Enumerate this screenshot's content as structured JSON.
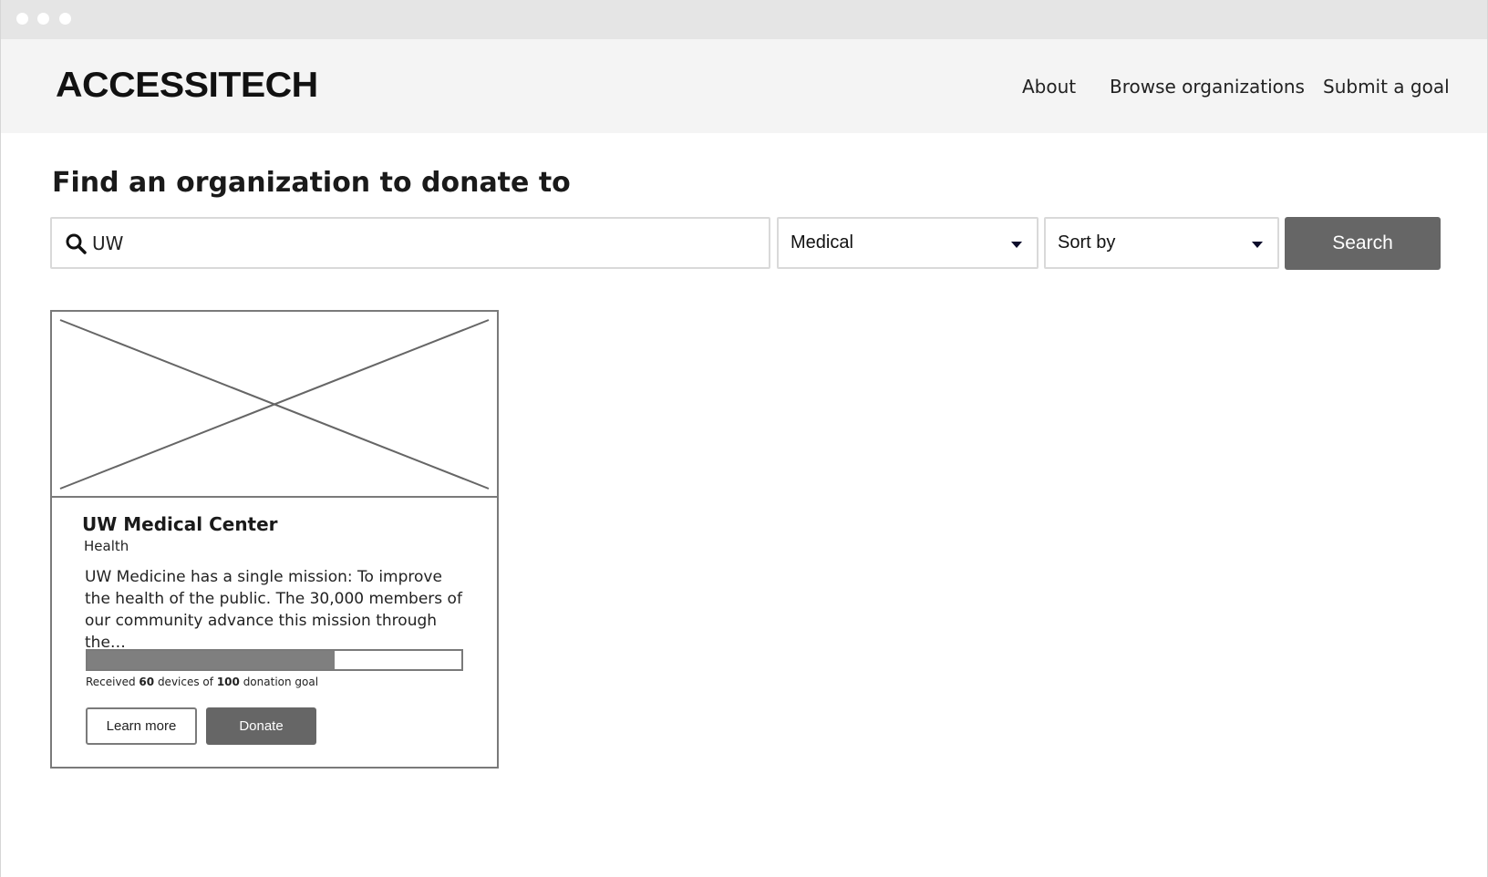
{
  "app": {
    "logo": "ACCESSITECH"
  },
  "nav": {
    "items": [
      {
        "label": "About"
      },
      {
        "label": "Browse organizations"
      },
      {
        "label": "Submit a goal"
      }
    ]
  },
  "main": {
    "title": "Find an organization to donate to",
    "search": {
      "value": "UW",
      "placeholder": ""
    },
    "category_select": {
      "value": "Medical"
    },
    "sort_select": {
      "value": "Sort by"
    },
    "search_button": "Search"
  },
  "results": [
    {
      "name": "UW Medical Center",
      "category": "Health",
      "description": "UW Medicine has a single mission: To improve the health of the public. The 30,000 members of our community advance this mission through the…",
      "progress": {
        "fraction": 0.66,
        "text_prefix": "Received ",
        "received": "60",
        "text_middle": " devices of ",
        "goal": "100",
        "text_suffix": " donation goal"
      },
      "learn_more_label": "Learn more",
      "donate_label": "Donate"
    }
  ],
  "colors": {
    "button_dark": "#666666",
    "nav_bg": "#f4f4f4",
    "titlebar_bg": "#e5e5e5",
    "progress_fill": "#7f7f7f"
  },
  "icons": {
    "search": "search-icon",
    "dropdown": "caret-down-icon",
    "image_placeholder": "image-placeholder-icon"
  }
}
